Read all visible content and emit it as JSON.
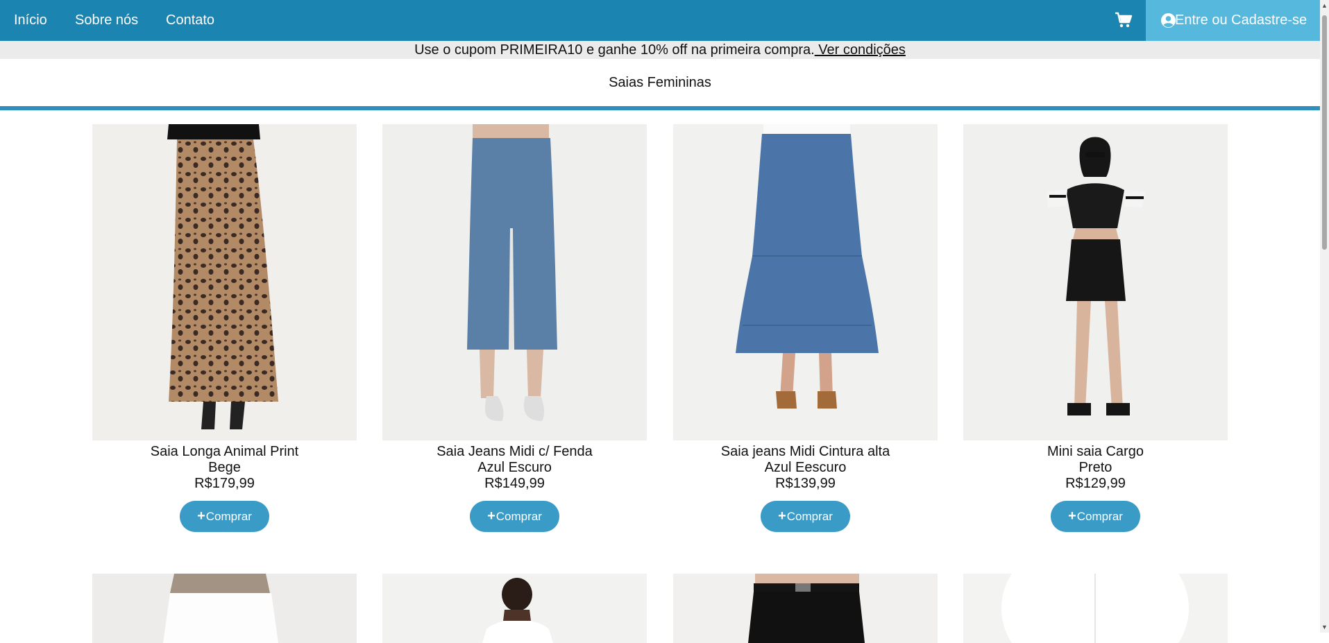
{
  "nav": {
    "links": [
      "Início",
      "Sobre nós",
      "Contato"
    ],
    "cart_icon": "shopping-cart-icon",
    "login_label": "Entre ou Cadastre-se",
    "login_icon": "user-circle-icon",
    "bar_color": "#1c84b0",
    "login_bg": "#57b8dd"
  },
  "promo": {
    "text": "Use o cupom PRIMEIRA10 e ganhe 10% off na primeira compra.",
    "link": " Ver condições"
  },
  "page": {
    "title": "Saias Femininas"
  },
  "products": [
    {
      "name": "Saia Longa Animal Print",
      "color": "Bege",
      "price": "R$179,99",
      "button": "Comprar"
    },
    {
      "name": "Saia Jeans Midi c/ Fenda",
      "color": "Azul Escuro",
      "price": "R$149,99",
      "button": "Comprar"
    },
    {
      "name": "Saia jeans Midi Cintura alta",
      "color": "Azul Eescuro",
      "price": "R$139,99",
      "button": "Comprar"
    },
    {
      "name": "Mini saia Cargo",
      "color": "Preto",
      "price": "R$129,99",
      "button": "Comprar"
    }
  ],
  "accent": "#3a9bc7"
}
